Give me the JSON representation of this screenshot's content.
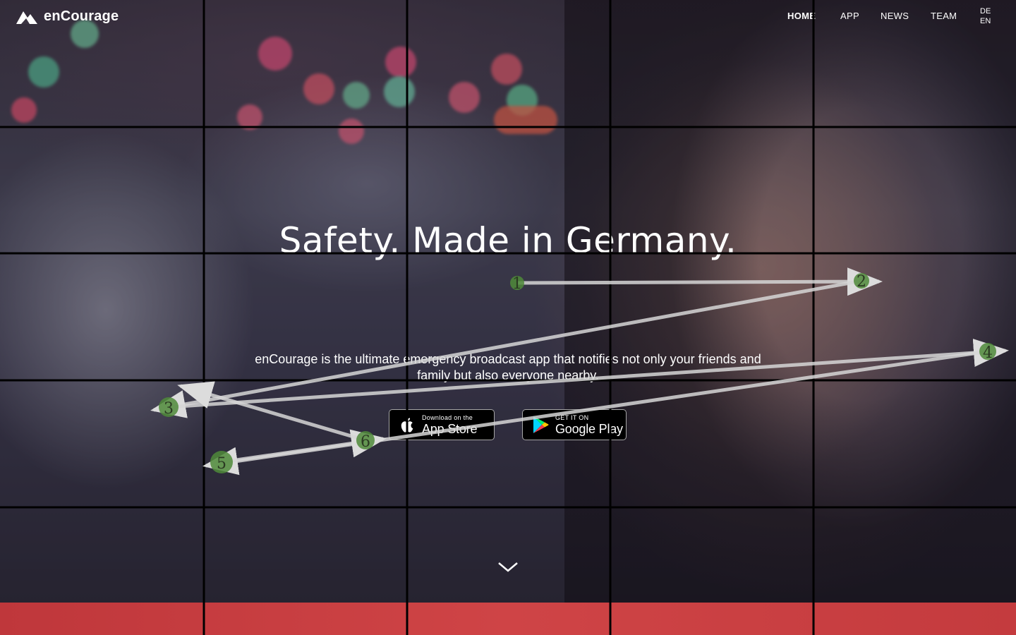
{
  "brand": {
    "name": "enCourage",
    "logo_icon": "mountain-logo-icon"
  },
  "nav": {
    "items": [
      {
        "label": "HOME",
        "active": true
      },
      {
        "label": "APP",
        "active": false
      },
      {
        "label": "NEWS",
        "active": false
      },
      {
        "label": "TEAM",
        "active": false
      }
    ],
    "languages": [
      "DE",
      "EN"
    ]
  },
  "hero": {
    "headline": "Safety. Made in Germany.",
    "subline": "enCourage is the ultimate emergency broadcast app that notifies not only your friends and family but also everyone nearby.",
    "app_store": {
      "small": "Download on the",
      "big": "App Store",
      "icon": "apple-icon"
    },
    "google_play": {
      "small": "GET IT ON",
      "big": "Google Play",
      "icon": "google-play-icon"
    },
    "scroll_icon": "chevron-down-icon"
  },
  "colors": {
    "band": "#c9403f",
    "gaze_marker": "#4f8a3a",
    "gaze_line": "#d6d6d6",
    "grid": "#000000"
  },
  "gaze_path": {
    "labels": [
      "1",
      "2",
      "3",
      "4",
      "5",
      "6"
    ]
  }
}
